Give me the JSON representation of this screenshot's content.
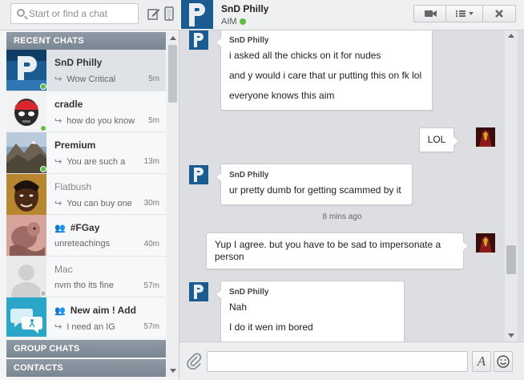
{
  "search": {
    "placeholder": "Start or find a chat"
  },
  "sections": {
    "recent": "RECENT CHATS",
    "group": "GROUP CHATS",
    "contacts": "CONTACTS"
  },
  "recent_chats": [
    {
      "name": "SnD Philly",
      "preview": "Wow Critical",
      "time": "5m",
      "status": "online",
      "avatar": "blue-logo"
    },
    {
      "name": "cradle",
      "preview": "how do you know",
      "time": "5m",
      "status": "online",
      "avatar": "red-mask"
    },
    {
      "name": "Premium",
      "preview": "You are such a",
      "time": "13m",
      "status": "online",
      "avatar": "mountain"
    },
    {
      "name": "Flatbush",
      "preview": "You can buy one",
      "time": "30m",
      "status": "offline",
      "avatar": "face-photo"
    },
    {
      "name": "#FGay",
      "preview": "unreteachings",
      "time": "40m",
      "status": "group",
      "avatar": "drawing"
    },
    {
      "name": "Mac",
      "preview": "nvm tho its fine",
      "time": "57m",
      "status": "offline",
      "avatar": "default-person"
    },
    {
      "name": "New aim ! Add",
      "preview": "I need an IG",
      "time": "57m",
      "status": "group",
      "avatar": "aim-group"
    }
  ],
  "conversation": {
    "name": "SnD Philly",
    "status": "AIM",
    "composer_placeholder": "",
    "font_button": "A"
  },
  "messages": [
    {
      "dir": "in",
      "sender": "SnD Philly",
      "lines": [
        "i asked all the chicks on it for nudes",
        "and y would i care that ur putting this on fk lol",
        "everyone knows this aim"
      ]
    },
    {
      "dir": "out",
      "lines": [
        "LOL"
      ]
    },
    {
      "dir": "in",
      "sender": "SnD Philly",
      "lines": [
        "ur pretty dumb for getting scammed by it"
      ]
    },
    {
      "dir": "time",
      "text": "8 mins ago"
    },
    {
      "dir": "out",
      "lines": [
        "Yup I agree. but you have to be sad to impersonate a person"
      ]
    },
    {
      "dir": "in",
      "sender": "SnD Philly",
      "lines": [
        "Nah",
        "I do it wen im bored"
      ]
    }
  ],
  "colors": {
    "online": "#5cbf3c",
    "offline": "#b6b9bd",
    "section_header": "#8590a0",
    "accent": "#1b7ab5"
  }
}
